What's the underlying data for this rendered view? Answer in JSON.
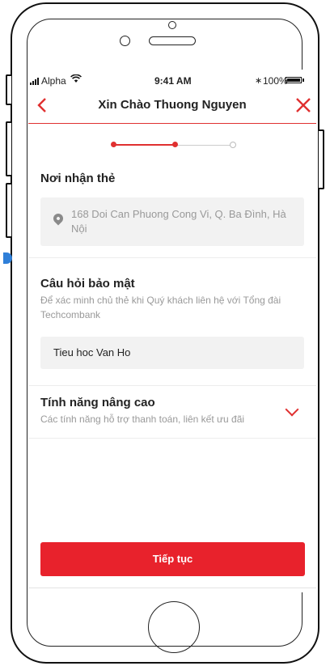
{
  "status_bar": {
    "carrier": "Alpha",
    "time": "9:41 AM",
    "battery": "100%"
  },
  "header": {
    "title": "Xin Chào Thuong Nguyen"
  },
  "stepper": {
    "steps": 3,
    "current": 2
  },
  "delivery": {
    "title": "Nơi nhận thẻ",
    "address": "168 Doi Can Phuong Cong Vi, Q. Ba Đình, Hà Nội"
  },
  "security": {
    "title": "Câu hỏi bảo mật",
    "description": "Để xác minh chủ thẻ khi Quý khách liên hệ với Tổng đài Techcombank",
    "answer": "Tieu hoc Van Ho"
  },
  "advanced": {
    "title": "Tính năng nâng cao",
    "description": "Các tính năng hỗ trợ thanh toán, liên kết ưu đãi"
  },
  "actions": {
    "continue_label": "Tiếp tục"
  },
  "colors": {
    "accent": "#e8222c",
    "field_bg": "#f2f2f2",
    "muted_text": "#999999"
  }
}
